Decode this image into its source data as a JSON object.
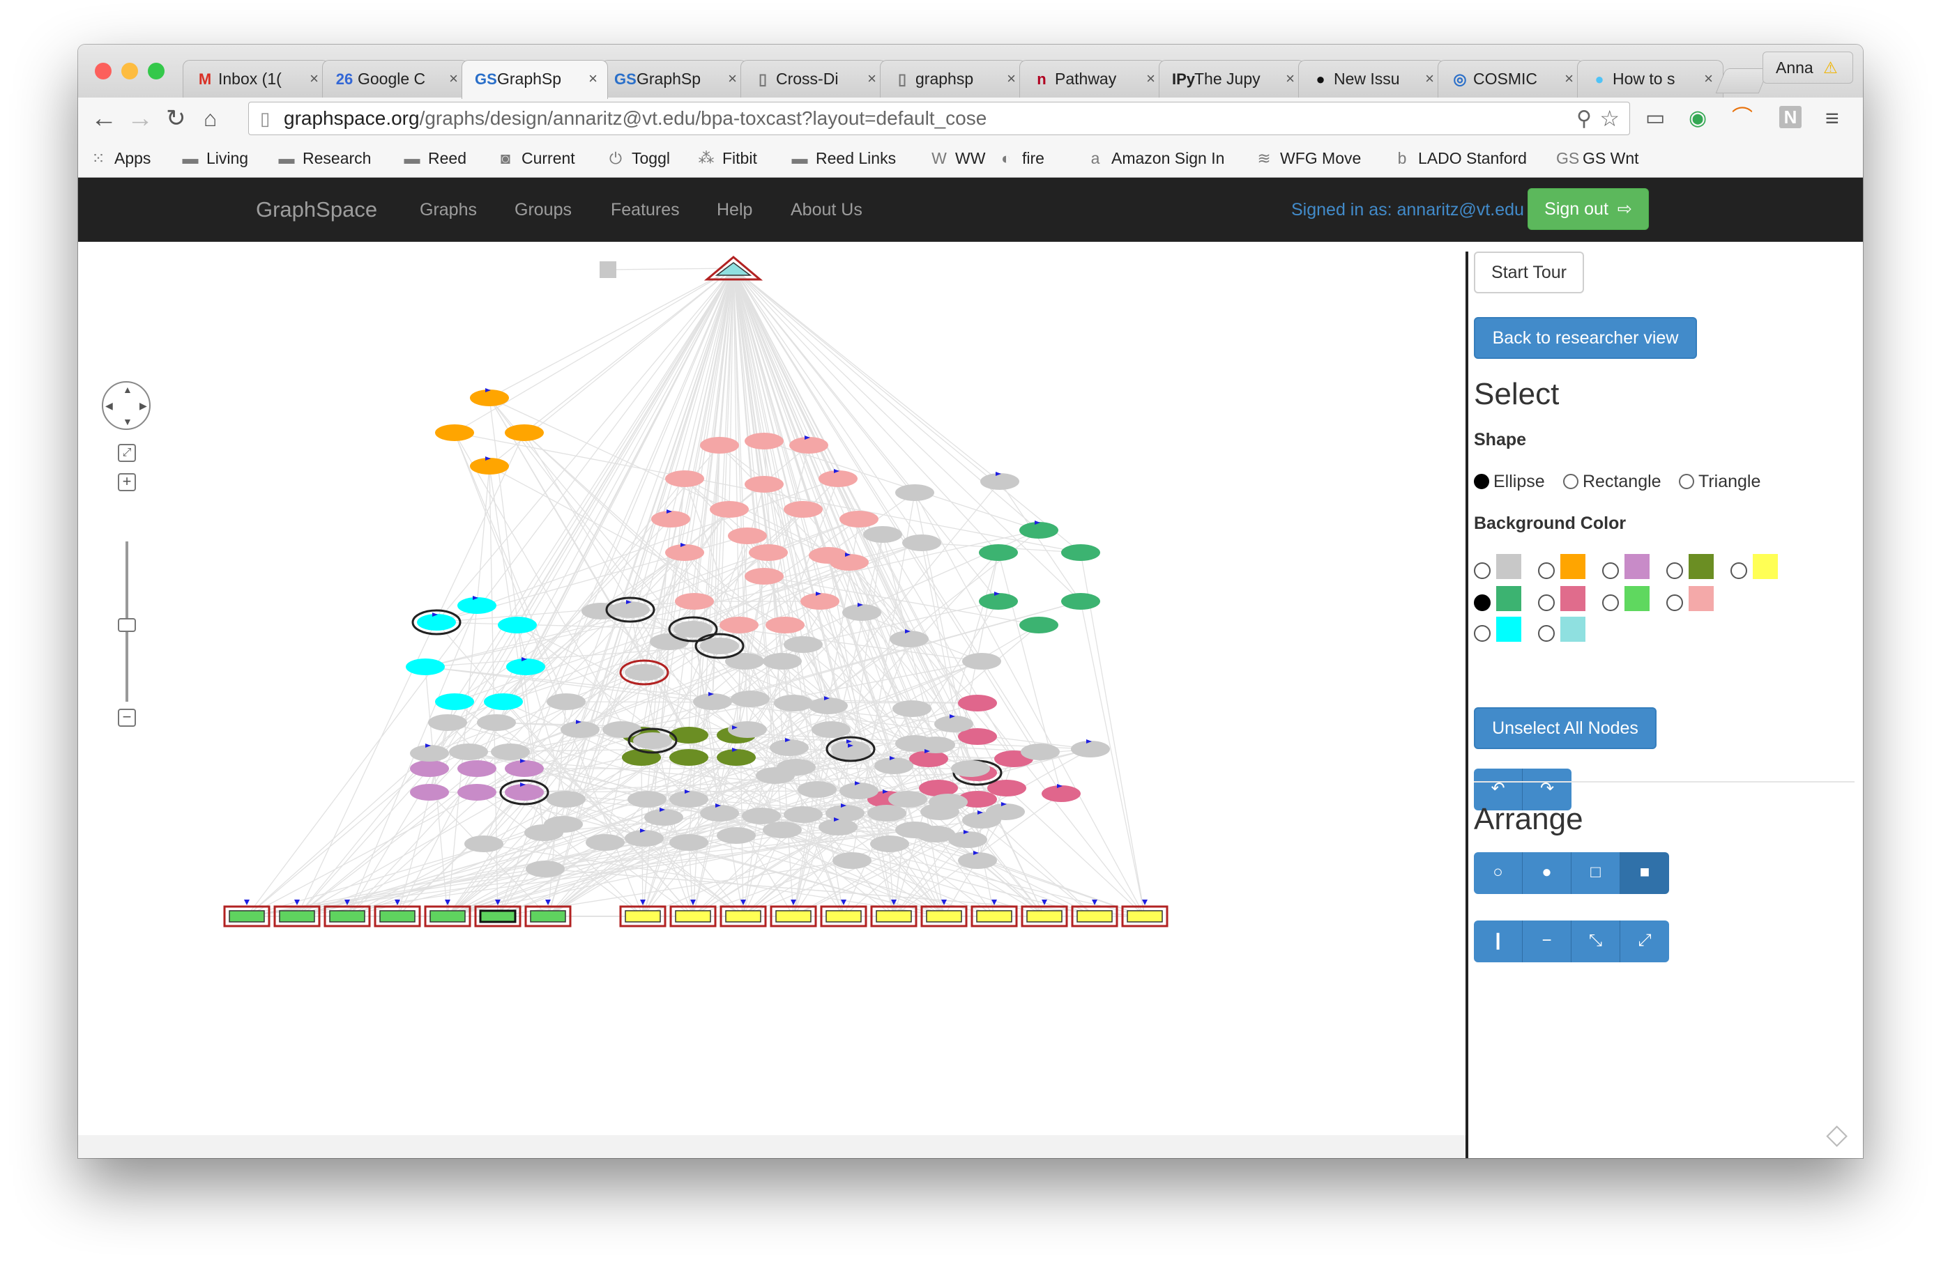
{
  "browser": {
    "profile_name": "Anna",
    "profile_warning": "⚠",
    "url_host": "graphspace.org",
    "url_path": "/graphs/design/annaritz@vt.edu/bpa-toxcast?layout=default_cose",
    "tabs": [
      {
        "label": "Inbox (1(",
        "icon": "M",
        "icon_color": "#d93025",
        "active": false
      },
      {
        "label": "Google C",
        "icon": "26",
        "icon_color": "#3367d6",
        "active": false
      },
      {
        "label": "GraphSp",
        "icon": "GS",
        "icon_color": "#2a6fc9",
        "active": true
      },
      {
        "label": "GraphSp",
        "icon": "GS",
        "icon_color": "#2a6fc9",
        "active": false
      },
      {
        "label": "Cross-Di",
        "icon": "▯",
        "icon_color": "#777",
        "active": false
      },
      {
        "label": "graphsp",
        "icon": "▯",
        "icon_color": "#777",
        "active": false
      },
      {
        "label": "Pathway",
        "icon": "n",
        "icon_color": "#b00020",
        "active": false
      },
      {
        "label": "The Jupy",
        "icon": "IPy",
        "icon_color": "#222",
        "active": false
      },
      {
        "label": "New Issu",
        "icon": "●",
        "icon_color": "#111",
        "active": false
      },
      {
        "label": "COSMIC",
        "icon": "◎",
        "icon_color": "#2a6fc9",
        "active": false
      },
      {
        "label": "How to s",
        "icon": "●",
        "icon_color": "#4fc3f7",
        "active": false
      }
    ],
    "bookmarks": [
      {
        "label": "Apps",
        "icon": "⁙",
        "icon_name": "apps-grid-icon"
      },
      {
        "label": "Living",
        "icon": "▬",
        "icon_name": "folder-icon"
      },
      {
        "label": "Research",
        "icon": "▬",
        "icon_name": "folder-icon"
      },
      {
        "label": "Reed",
        "icon": "▬",
        "icon_name": "folder-icon"
      },
      {
        "label": "Current",
        "icon": "◙",
        "icon_name": "current-icon"
      },
      {
        "label": "Toggl",
        "icon": "⏻",
        "icon_name": "toggl-icon"
      },
      {
        "label": "Fitbit",
        "icon": "⁂",
        "icon_name": "fitbit-icon"
      },
      {
        "label": "Reed Links",
        "icon": "▬",
        "icon_name": "folder-icon"
      },
      {
        "label": "WW",
        "icon": "W",
        "icon_name": "ww-icon"
      },
      {
        "label": "fire",
        "icon": "◐",
        "icon_name": "fire-icon"
      },
      {
        "label": "Amazon Sign In",
        "icon": "a",
        "icon_name": "amazon-icon"
      },
      {
        "label": "WFG Move",
        "icon": "≋",
        "icon_name": "wfg-icon"
      },
      {
        "label": "LADO Stanford",
        "icon": "b",
        "icon_name": "lado-icon"
      },
      {
        "label": "GS Wnt",
        "icon": "GS",
        "icon_name": "graphspace-icon"
      }
    ]
  },
  "nav": {
    "brand": "GraphSpace",
    "items": [
      "Graphs",
      "Groups",
      "Features",
      "Help",
      "About Us"
    ],
    "signed_in": "Signed in as: annaritz@vt.edu",
    "sign_out": "Sign out"
  },
  "panel": {
    "start_tour": "Start Tour",
    "back_to_researcher": "Back to researcher view",
    "select_heading": "Select",
    "shape_heading": "Shape",
    "shapes": [
      {
        "label": "Ellipse",
        "checked": true
      },
      {
        "label": "Rectangle",
        "checked": false
      },
      {
        "label": "Triangle",
        "checked": false
      }
    ],
    "bg_color_heading": "Background Color",
    "colors": [
      [
        {
          "hex": "#c8c8c8",
          "checked": false
        },
        {
          "hex": "#ffa500",
          "checked": false
        },
        {
          "hex": "#c88bc8",
          "checked": false
        },
        {
          "hex": "#6b8e23",
          "checked": false
        },
        {
          "hex": "#ffff55",
          "checked": false
        }
      ],
      [
        {
          "hex": "#3cb371",
          "checked": true
        },
        {
          "hex": "#e06c8c",
          "checked": false
        },
        {
          "hex": "#5fd85f",
          "checked": false
        },
        {
          "hex": "#f4a9a9",
          "checked": false
        }
      ],
      [
        {
          "hex": "#00ffff",
          "checked": false
        },
        {
          "hex": "#8fe0e0",
          "checked": false
        }
      ]
    ],
    "unselect_all": "Unselect All Nodes",
    "arrange_heading": "Arrange"
  },
  "graph": {
    "colors": {
      "grey": "#c9c9c9",
      "orange": "#ffa500",
      "pink": "#f4a6a6",
      "green": "#3cb371",
      "cyan": "#00ffff",
      "olive": "#6b8e23",
      "purple": "#c88bc8",
      "rose": "#e0668c",
      "rect_green": "#5fd35f",
      "rect_yellow": "#ffff55",
      "rect_border": "#b22222",
      "arrow": "#1e1ee0",
      "edge": "#d8d8d8"
    }
  }
}
